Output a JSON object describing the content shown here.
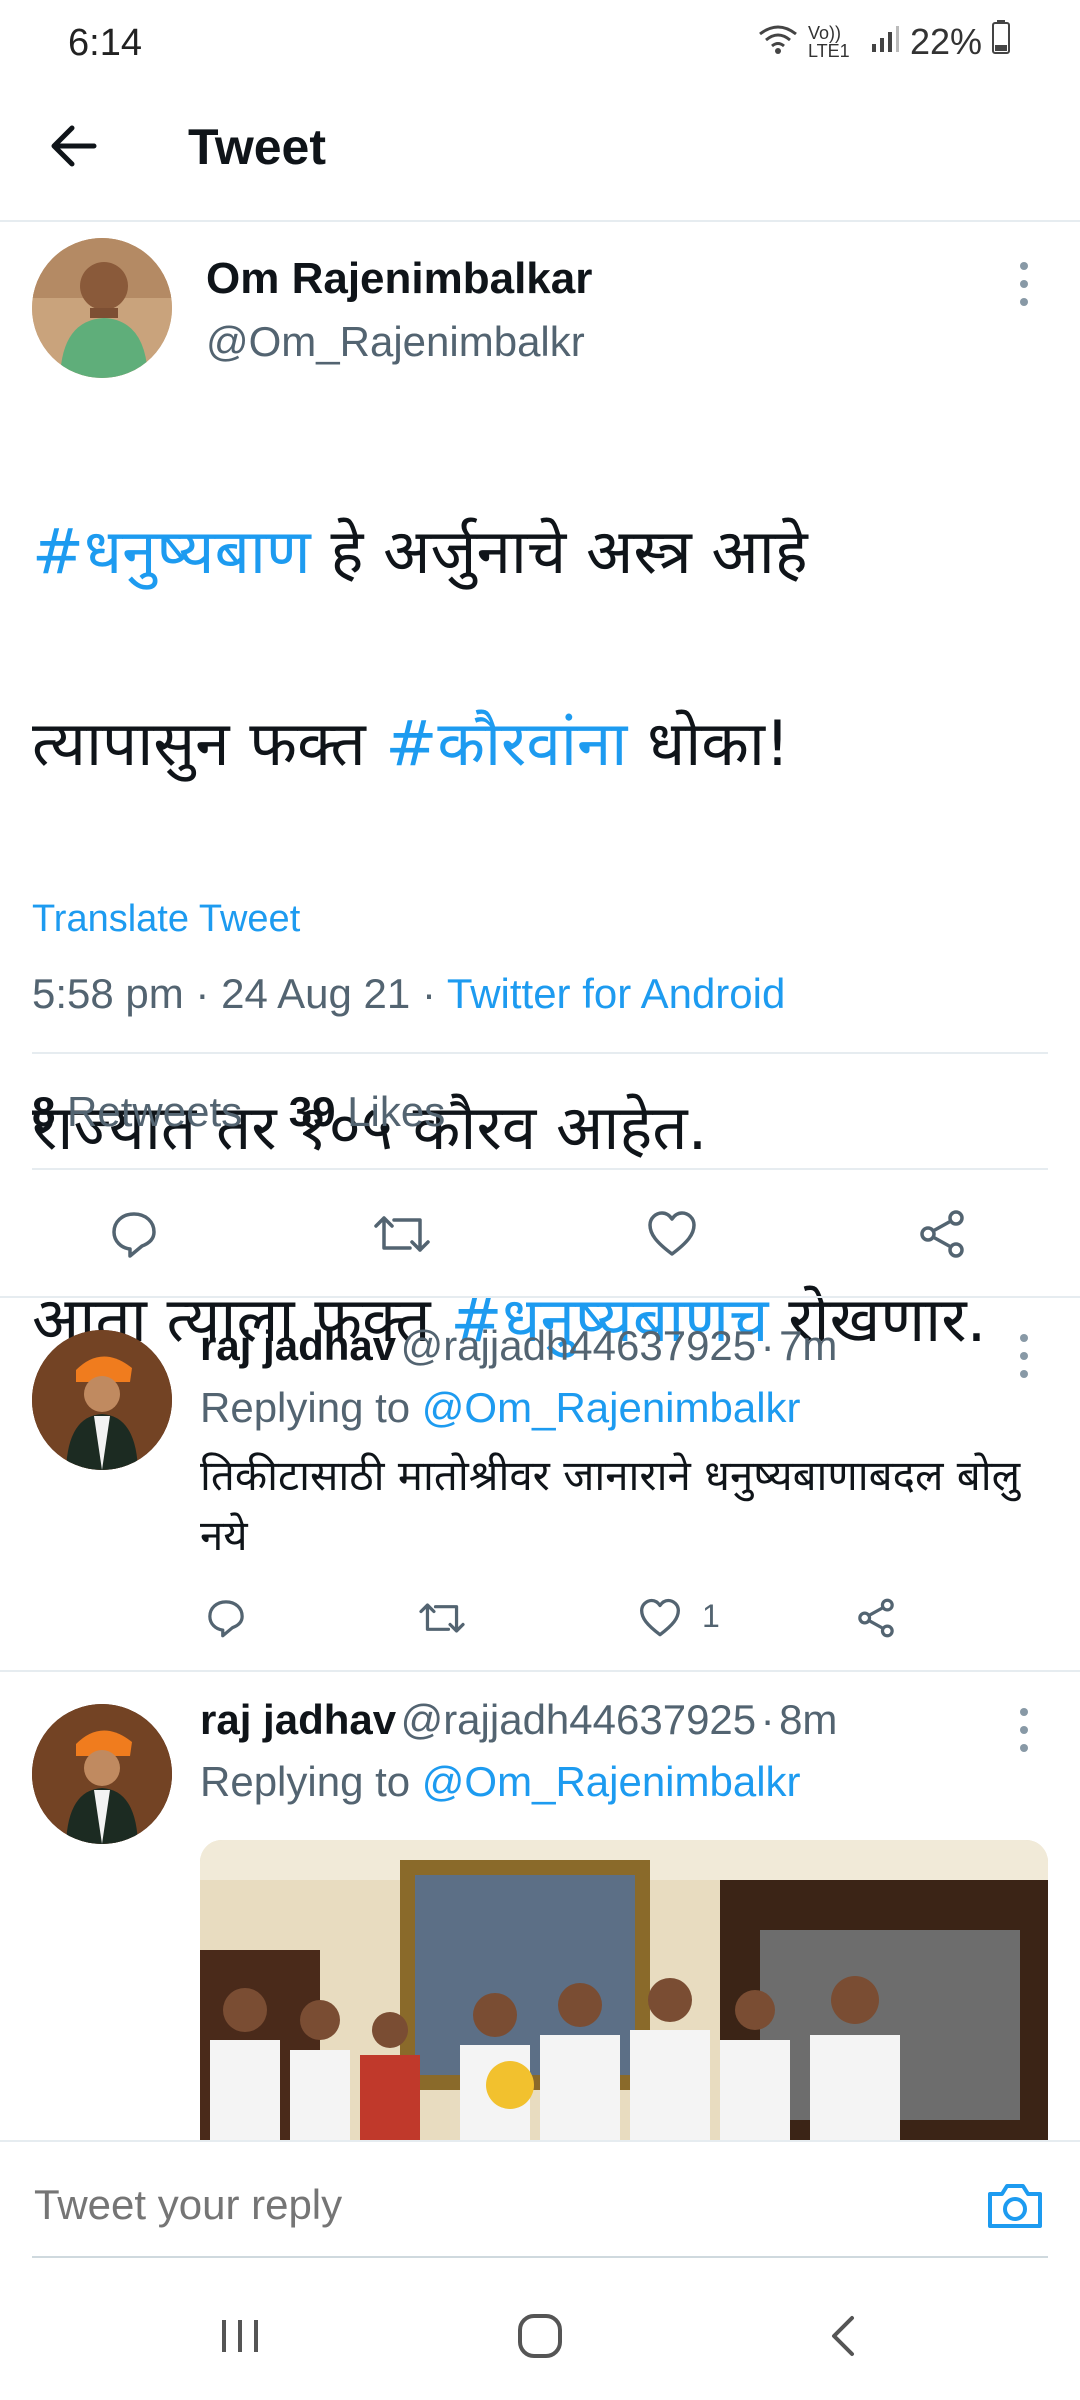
{
  "status_bar": {
    "time": "6:14",
    "network": "Vo)) LTE1",
    "battery": "22%"
  },
  "header": {
    "title": "Tweet"
  },
  "tweet": {
    "author_name": "Om Rajenimbalkar",
    "author_handle": "@Om_Rajenimbalkr",
    "lines": [
      {
        "tag1": "#धनुष्यबाण",
        "text1": " हे अर्जुनाचे अस्त्र आहे"
      },
      {
        "text1": "त्यापासुन फक्त ",
        "tag1": "#कौरवांना",
        "text2": " धोका!"
      },
      {
        "text1": "राज्यात तर १०५ कौरव आहेत."
      },
      {
        "text1": "आता त्याला फक्त ",
        "tag1": "#धनुष्यबाणच",
        "text2": " रोखणार."
      }
    ],
    "translate_label": "Translate Tweet",
    "time": "5:58 pm",
    "date": "24 Aug 21",
    "source": "Twitter for Android",
    "retweets_count": "8",
    "retweets_label": "Retweets",
    "likes_count": "39",
    "likes_label": "Likes"
  },
  "replies": [
    {
      "name": "raj jadhav",
      "handle": "@rajjadh44637925",
      "age": "7m",
      "replying_label": "Replying to",
      "replying_to": "@Om_Rajenimbalkr",
      "text": "तिकीटासाठी मातोश्रीवर जानाराने धनुष्यबाणाबदल बोलु नये",
      "likes": "1"
    },
    {
      "name": "raj jadhav",
      "handle": "@rajjadh44637925",
      "age": "8m",
      "replying_label": "Replying to",
      "replying_to": "@Om_Rajenimbalkr"
    }
  ],
  "composer": {
    "placeholder": "Tweet your reply"
  },
  "colors": {
    "accent": "#1d9bf0",
    "text": "#0f1419",
    "muted": "#536471",
    "divider": "#e6ecf0"
  }
}
